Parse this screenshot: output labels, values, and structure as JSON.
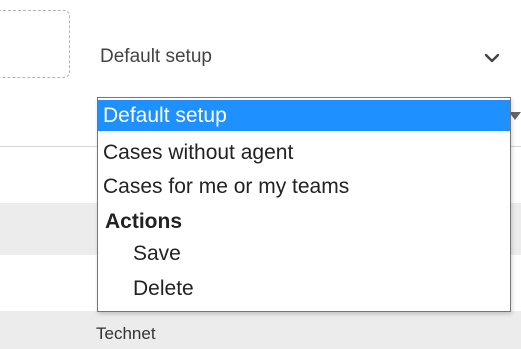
{
  "select": {
    "value": "Default setup",
    "icon": "chevron-down-icon"
  },
  "dropdown": {
    "options": [
      {
        "label": "Default setup",
        "selected": true
      },
      {
        "label": "Cases without agent",
        "selected": false
      },
      {
        "label": "Cases for me or my teams",
        "selected": false
      }
    ],
    "group": {
      "label": "Actions",
      "options": [
        {
          "label": "Save"
        },
        {
          "label": "Delete"
        }
      ]
    }
  },
  "background": {
    "row_label": "Technet"
  },
  "colors": {
    "selected_bg": "#1e90ff",
    "row_bg": "#ececec"
  }
}
